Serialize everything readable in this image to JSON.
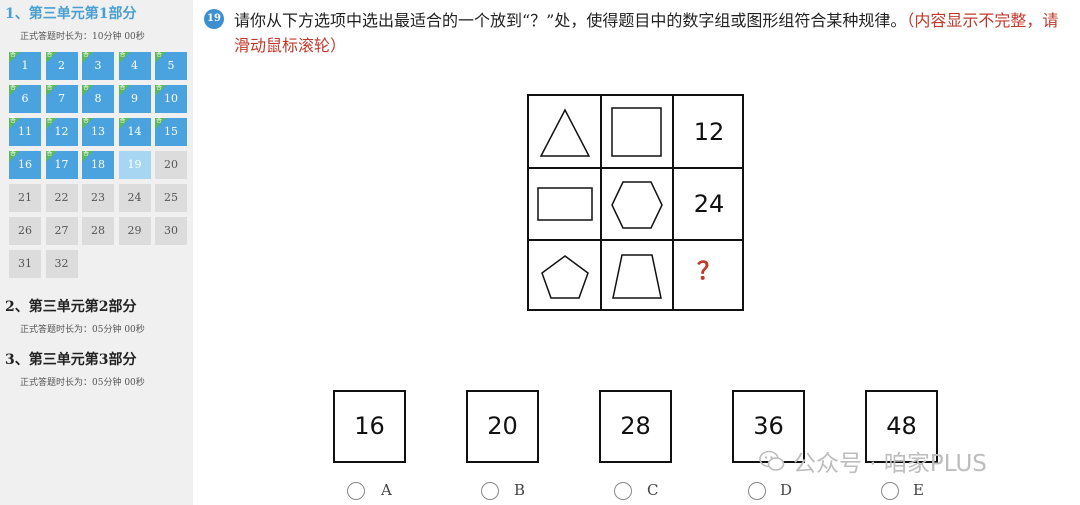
{
  "sidebar": {
    "sections": [
      {
        "title": "1、第三单元第1部分",
        "subtitle": "正式答题时长为：10分钟 00秒",
        "active": true
      },
      {
        "title": "2、第三单元第2部分",
        "subtitle": "正式答题时长为：05分钟 00秒",
        "active": false
      },
      {
        "title": "3、第三单元第3部分",
        "subtitle": "正式答题时长为：05分钟 00秒",
        "active": false
      }
    ],
    "answered_flag": "答",
    "questions": [
      {
        "n": "1",
        "state": "answered"
      },
      {
        "n": "2",
        "state": "answered"
      },
      {
        "n": "3",
        "state": "answered"
      },
      {
        "n": "4",
        "state": "answered"
      },
      {
        "n": "5",
        "state": "answered"
      },
      {
        "n": "6",
        "state": "answered"
      },
      {
        "n": "7",
        "state": "answered"
      },
      {
        "n": "8",
        "state": "answered"
      },
      {
        "n": "9",
        "state": "answered"
      },
      {
        "n": "10",
        "state": "answered"
      },
      {
        "n": "11",
        "state": "answered"
      },
      {
        "n": "12",
        "state": "answered"
      },
      {
        "n": "13",
        "state": "answered"
      },
      {
        "n": "14",
        "state": "answered"
      },
      {
        "n": "15",
        "state": "answered"
      },
      {
        "n": "16",
        "state": "answered"
      },
      {
        "n": "17",
        "state": "answered"
      },
      {
        "n": "18",
        "state": "answered"
      },
      {
        "n": "19",
        "state": "current"
      },
      {
        "n": "20",
        "state": "todo"
      },
      {
        "n": "21",
        "state": "todo"
      },
      {
        "n": "22",
        "state": "todo"
      },
      {
        "n": "23",
        "state": "todo"
      },
      {
        "n": "24",
        "state": "todo"
      },
      {
        "n": "25",
        "state": "todo"
      },
      {
        "n": "26",
        "state": "todo"
      },
      {
        "n": "27",
        "state": "todo"
      },
      {
        "n": "28",
        "state": "todo"
      },
      {
        "n": "29",
        "state": "todo"
      },
      {
        "n": "30",
        "state": "todo"
      },
      {
        "n": "31",
        "state": "todo"
      },
      {
        "n": "32",
        "state": "todo"
      }
    ],
    "flagged_with_mark": [
      "1",
      "2",
      "3",
      "4",
      "5",
      "6",
      "7",
      "8",
      "9",
      "10",
      "11",
      "12",
      "13",
      "14",
      "15",
      "16",
      "17",
      "18"
    ]
  },
  "question": {
    "number": "19",
    "text": "请你从下方选项中选出最适合的一个放到“？”处，使得题目中的数字组或图形组符合某种规律。",
    "hint": "（内容显示不完整，请滑动鼠标滚轮）",
    "grid": [
      [
        "triangle-icon",
        "square-icon",
        "12"
      ],
      [
        "rectangle-icon",
        "hexagon-icon",
        "24"
      ],
      [
        "pentagon-icon",
        "trapezoid-icon",
        "？"
      ]
    ]
  },
  "options": [
    {
      "value": "16",
      "letter": "A"
    },
    {
      "value": "20",
      "letter": "B"
    },
    {
      "value": "28",
      "letter": "C"
    },
    {
      "value": "36",
      "letter": "D"
    },
    {
      "value": "48",
      "letter": "E"
    }
  ],
  "watermark": "公众号 · 咱家PLUS",
  "colors": {
    "accent": "#3d8fd1",
    "answered": "#4aa3df",
    "current": "#a7d6f3",
    "todo": "#dcdcdc",
    "hint": "#c0392b",
    "flag": "#5cb85c"
  }
}
